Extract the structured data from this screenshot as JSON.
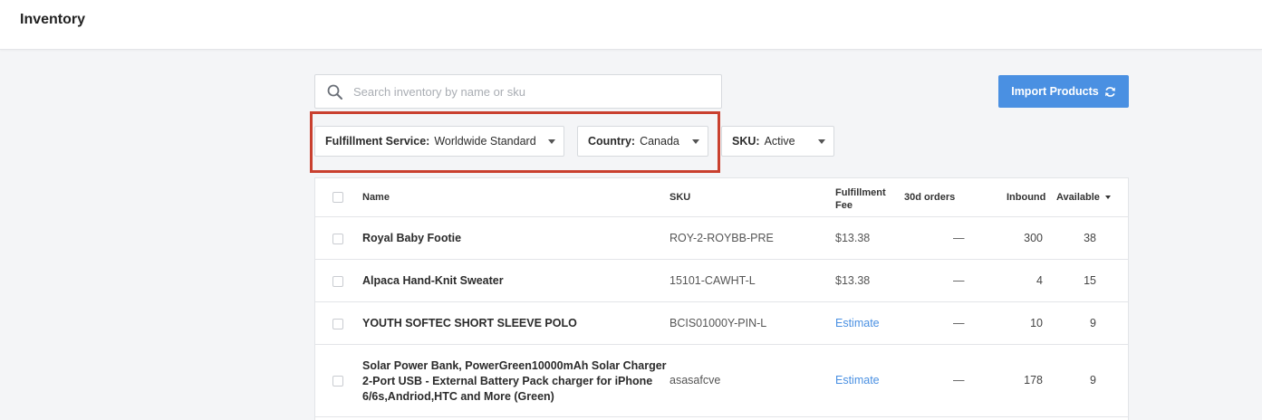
{
  "header": {
    "title": "Inventory"
  },
  "search": {
    "placeholder": "Search inventory by name or sku",
    "value": ""
  },
  "actions": {
    "import_label": "Import Products"
  },
  "filters": {
    "fulfillment_service": {
      "label": "Fulfillment Service:",
      "value": "Worldwide Standard"
    },
    "country": {
      "label": "Country:",
      "value": "Canada"
    },
    "sku": {
      "label": "SKU:",
      "value": "Active"
    }
  },
  "table": {
    "columns": {
      "name": "Name",
      "sku": "SKU",
      "fee_line1": "Fulfillment",
      "fee_line2": "Fee",
      "orders": "30d orders",
      "inbound": "Inbound",
      "available": "Available"
    },
    "rows": [
      {
        "name": "Royal Baby Footie",
        "sku": "ROY-2-ROYBB-PRE",
        "fee": "$13.38",
        "orders": "—",
        "inbound": "300",
        "available": "38"
      },
      {
        "name": "Alpaca Hand-Knit Sweater",
        "sku": "15101-CAWHT-L",
        "fee": "$13.38",
        "orders": "—",
        "inbound": "4",
        "available": "15"
      },
      {
        "name": "YOUTH SOFTEC SHORT SLEEVE POLO",
        "sku": "BCIS01000Y-PIN-L",
        "fee": "Estimate",
        "orders": "—",
        "inbound": "10",
        "available": "9"
      },
      {
        "name_lines": [
          "Solar Power Bank, PowerGreen10000mAh Solar Charger",
          "2-Port USB - External Battery Pack charger for iPhone",
          "6/6s,Andriod,HTC and More (Green)"
        ],
        "sku": "asasafcve",
        "fee": "Estimate",
        "orders": "—",
        "inbound": "178",
        "available": "9"
      }
    ]
  },
  "colors": {
    "accent": "#4a90e2",
    "highlight": "#c9402f"
  }
}
